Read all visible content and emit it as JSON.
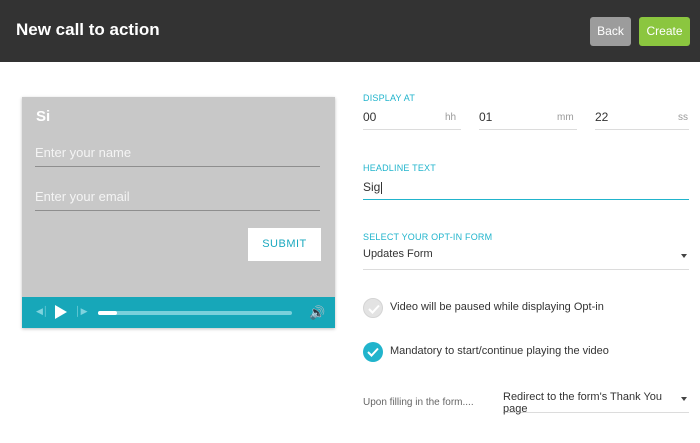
{
  "header": {
    "title": "New call to action",
    "back_label": "Back",
    "create_label": "Create"
  },
  "preview": {
    "headline": "Si",
    "name_placeholder": "Enter your name",
    "email_placeholder": "Enter your email",
    "submit_label": "SUBMIT",
    "player": {
      "prev_icon": "skip-back-icon",
      "play_icon": "play-icon",
      "next_icon": "skip-forward-icon",
      "volume_icon": "volume-icon",
      "progress": 0.1
    }
  },
  "display_at": {
    "label": "DISPLAY AT",
    "hh_value": "00",
    "hh_unit": "hh",
    "mm_value": "01",
    "mm_unit": "mm",
    "ss_value": "22",
    "ss_unit": "ss"
  },
  "headline_text": {
    "label": "HEADLINE TEXT",
    "value": "Sig"
  },
  "optin": {
    "label": "SELECT YOUR OPT-IN FORM",
    "selected": "Updates Form"
  },
  "options": {
    "pause_text": "Video will be paused while displaying Opt-in",
    "pause_checked": false,
    "mandatory_text": "Mandatory to start/continue playing the video",
    "mandatory_checked": true
  },
  "upon": {
    "label": "Upon filling in the form....",
    "selected": "Redirect to the form's Thank You page"
  },
  "colors": {
    "accent": "#21b4cc",
    "create": "#8bc63f",
    "header": "#333333"
  }
}
